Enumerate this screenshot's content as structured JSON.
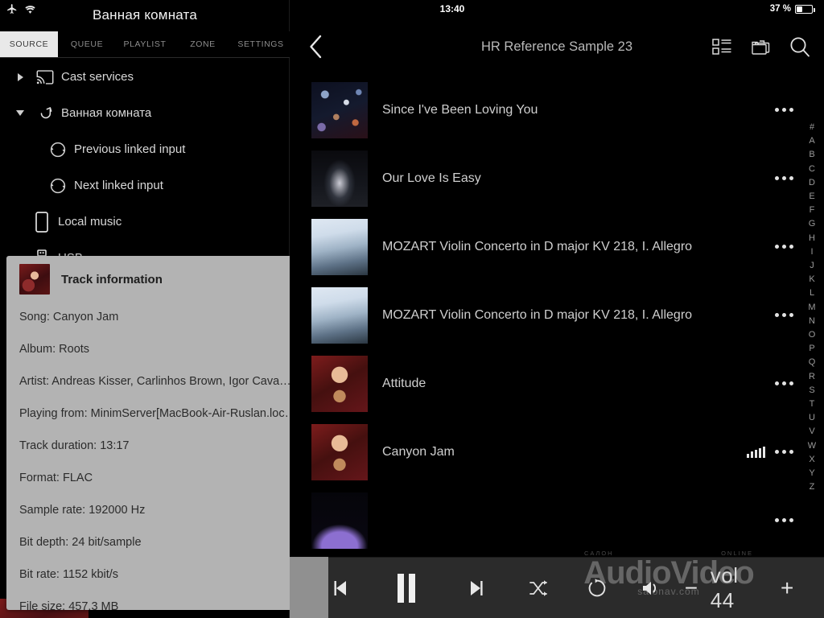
{
  "left": {
    "status": {
      "airplane_icon": "airplane-mode-icon",
      "wifi_icon": "wifi-icon"
    },
    "title": "Ванная комната",
    "tabs": [
      {
        "label": "SOURCE",
        "active": true
      },
      {
        "label": "QUEUE",
        "active": false
      },
      {
        "label": "PLAYLIST",
        "active": false
      },
      {
        "label": "ZONE",
        "active": false
      },
      {
        "label": "SETTINGS",
        "active": false
      }
    ],
    "tree": [
      {
        "label": "Cast services",
        "icon": "cast-icon",
        "expander": "collapsed",
        "indent": 0
      },
      {
        "label": "Ванная комната",
        "icon": "zone-link-icon",
        "expander": "expanded",
        "indent": 0
      },
      {
        "label": "Previous linked input",
        "icon": "circular-arrows-icon",
        "expander": "none",
        "indent": 1
      },
      {
        "label": "Next linked input",
        "icon": "circular-arrows-icon",
        "expander": "none",
        "indent": 1
      },
      {
        "label": "Local music",
        "icon": "phone-icon",
        "expander": "none",
        "indent": 2
      },
      {
        "label": "USB",
        "icon": "usb-icon",
        "expander": "none",
        "indent": 2
      }
    ]
  },
  "popup": {
    "title": "Track information",
    "cover_icon": "album-art-thumbnail",
    "rows": [
      "Song: Canyon Jam",
      "Album: Roots",
      "Artist: Andreas Kisser, Carlinhos Brown, Igor Cava…",
      "Playing from: MinimServer[MacBook-Air-Ruslan.loc…",
      "Track duration: 13:17",
      "Format: FLAC",
      "Sample rate: 192000 Hz",
      "Bit depth: 24 bit/sample",
      "Bit rate: 1152 kbit/s",
      "File size: 457.3 MB"
    ]
  },
  "right": {
    "status": {
      "clock": "13:40",
      "battery_percent": "37 %",
      "battery_icon": "battery-icon"
    },
    "header": {
      "back_icon": "chevron-left-icon",
      "title": "HR Reference Sample 23",
      "icons": [
        {
          "name": "list-view-icon"
        },
        {
          "name": "folders-icon"
        },
        {
          "name": "search-icon"
        }
      ]
    },
    "tracks": [
      {
        "title": "Since I've Been Loving You",
        "cover": "confetti-dark",
        "playing": false,
        "menu_icon": "overflow-menu-icon"
      },
      {
        "title": "Our Love Is Easy",
        "cover": "stage-light",
        "playing": false,
        "menu_icon": "overflow-menu-icon"
      },
      {
        "title": "MOZART Violin Concerto in D major KV 218, I. Allegro",
        "cover": "mozart-sky",
        "playing": false,
        "menu_icon": "overflow-menu-icon"
      },
      {
        "title": "MOZART Violin Concerto in D major KV 218, I. Allegro",
        "cover": "mozart-sky",
        "playing": false,
        "menu_icon": "overflow-menu-icon"
      },
      {
        "title": "Attitude",
        "cover": "roots-red",
        "playing": false,
        "menu_icon": "overflow-menu-icon"
      },
      {
        "title": "Canyon Jam",
        "cover": "roots-red",
        "playing": true,
        "menu_icon": "overflow-menu-icon"
      },
      {
        "title": "",
        "cover": "purple-nebula",
        "playing": false,
        "menu_icon": "overflow-menu-icon"
      }
    ],
    "alpha_index": [
      "#",
      "A",
      "B",
      "C",
      "D",
      "E",
      "F",
      "G",
      "H",
      "I",
      "J",
      "K",
      "L",
      "M",
      "N",
      "O",
      "P",
      "Q",
      "R",
      "S",
      "T",
      "U",
      "V",
      "W",
      "X",
      "Y",
      "Z"
    ]
  },
  "player": {
    "prev_icon": "previous-track-icon",
    "play_icon": "pause-icon",
    "next_icon": "next-track-icon",
    "shuffle_icon": "shuffle-icon",
    "repeat_icon": "repeat-icon",
    "speaker_icon": "speaker-icon",
    "volume_minus": "−",
    "volume_label": "vol 44",
    "volume_plus": "+"
  },
  "watermark": {
    "top_left": "CAЛOH",
    "top_right": "ONLINE",
    "main": "AudioVideo",
    "sub": "salonav.com"
  },
  "colors": {
    "background": "#000000",
    "panel_divider": "#1c1c1c",
    "active_tab_bg": "#e9e9e9",
    "active_tab_text": "#3a3a3a",
    "tab_text": "#8d8d8d",
    "primary_text": "#d8d8d8",
    "secondary_text": "#b9b9b9",
    "popup_bg": "#b3b3b3",
    "popup_text": "#2b2b2b",
    "player_bg": "#2b2b2b",
    "index_text": "#9a9a9a"
  }
}
